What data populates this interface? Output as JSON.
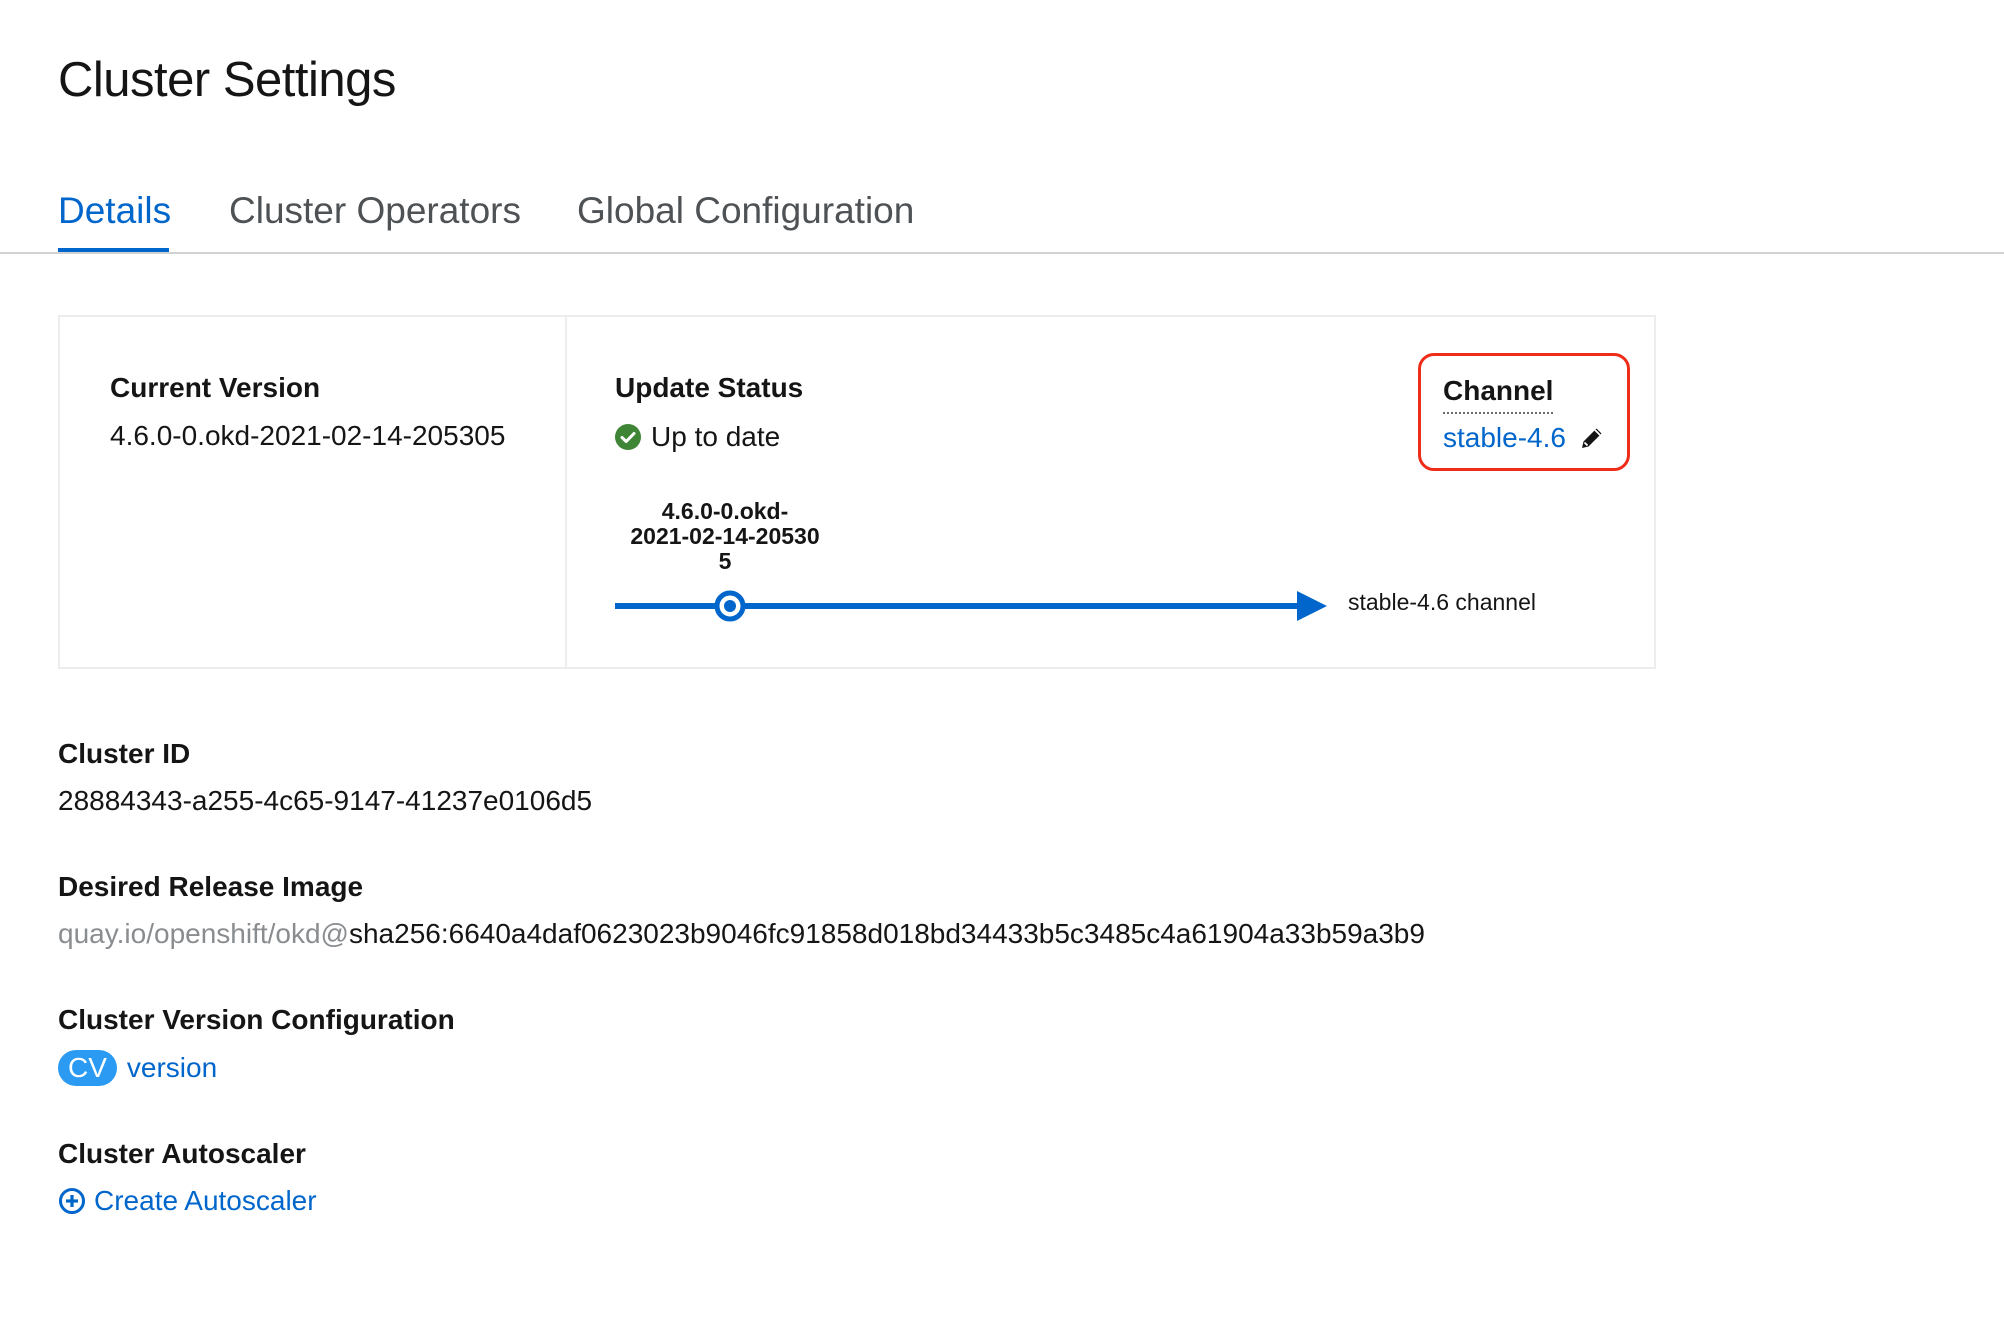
{
  "page": {
    "title": "Cluster Settings"
  },
  "tabs": [
    {
      "label": "Details",
      "active": true
    },
    {
      "label": "Cluster Operators",
      "active": false
    },
    {
      "label": "Global Configuration",
      "active": false
    }
  ],
  "summary": {
    "current_version_label": "Current Version",
    "current_version_value": "4.6.0-0.okd-2021-02-14-205305",
    "update_status_label": "Update Status",
    "update_status_value": "Up to date",
    "update_status_icon": "check-circle-icon",
    "channel_label": "Channel",
    "channel_value": "stable-4.6",
    "channel_edit_icon": "pencil-icon",
    "timeline_version_line1": "4.6.0-0.okd-",
    "timeline_version_line2": "2021-02-14-20530",
    "timeline_version_line3": "5",
    "timeline_channel_label": "stable-4.6 channel"
  },
  "details": {
    "cluster_id_label": "Cluster ID",
    "cluster_id_value": "28884343-a255-4c65-9147-41237e0106d5",
    "release_image_label": "Desired Release Image",
    "release_image_prefix": "quay.io/openshift/okd@",
    "release_image_digest": "sha256:6640a4daf0623023b9046fc91858d018bd34433b5c3485c4a61904a33b59a3b9",
    "cv_config_label": "Cluster Version Configuration",
    "cv_badge": "CV",
    "cv_link": "version",
    "autoscaler_label": "Cluster Autoscaler",
    "autoscaler_link": "Create Autoscaler",
    "autoscaler_icon": "plus-circle-icon"
  },
  "colors": {
    "link": "#0066cc",
    "success": "#3e8635",
    "highlight_box": "#ee2c1a",
    "cv_badge": "#2b9af3",
    "muted_text": "#8a8d90",
    "timeline": "#0066cc"
  }
}
